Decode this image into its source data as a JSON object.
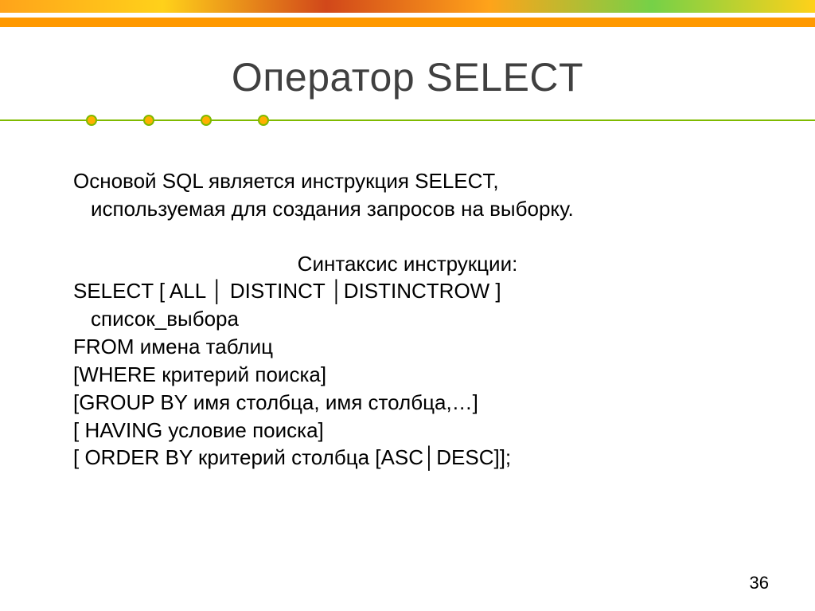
{
  "title": "Оператор SELECT",
  "intro_l1": "Основой SQL является инструкция SELECT,",
  "intro_l2": "используемая для создания запросов на выборку.",
  "syntax_heading": "Синтаксис инструкции:",
  "line_select": "SELECT [ ALL │ DISTINCT │DISTINCTROW ]",
  "line_select_cont": "список_выбора",
  "line_from": "FROM имена таблиц",
  "line_where": "[WHERE критерий поиска]",
  "line_groupby": "[GROUP BY имя столбца, имя столбца,…]",
  "line_having": "[ HAVING условие поиска]",
  "line_orderby": "[ ORDER BY критерий столбца [ASC│DESC]];",
  "page_number": "36"
}
